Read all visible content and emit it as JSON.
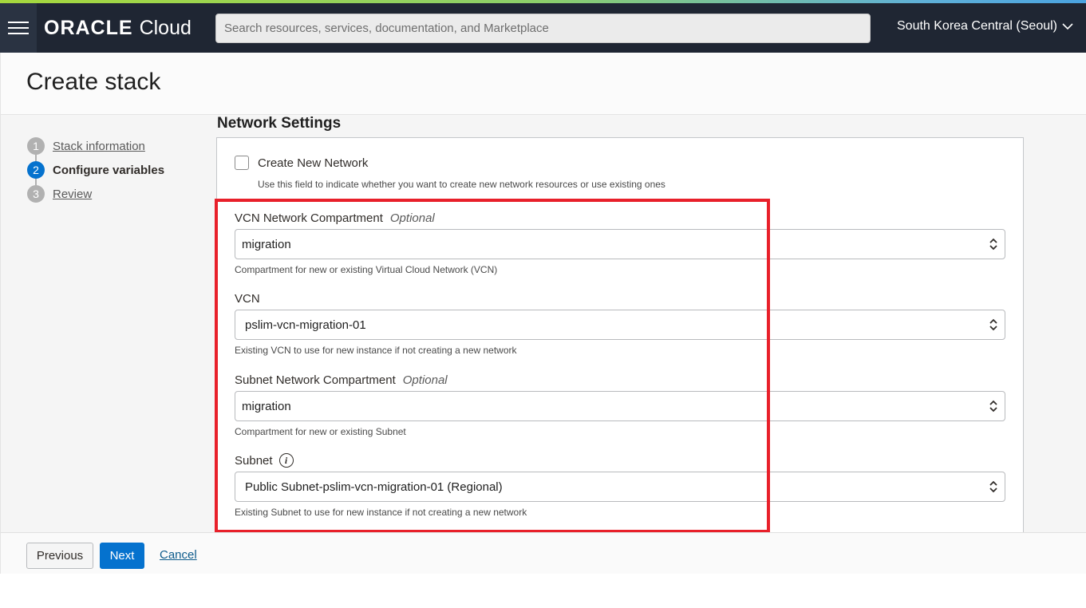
{
  "header": {
    "logo_brand": "ORACLE",
    "logo_product": "Cloud",
    "search_placeholder": "Search resources, services, documentation, and Marketplace",
    "region": "South Korea Central (Seoul)"
  },
  "page": {
    "title": "Create stack"
  },
  "steps": [
    {
      "number": "1",
      "label": "Stack information",
      "state": "completed"
    },
    {
      "number": "2",
      "label": "Configure variables",
      "state": "active"
    },
    {
      "number": "3",
      "label": "Review",
      "state": "pending"
    }
  ],
  "section": {
    "title": "Network Settings",
    "create_network": {
      "label": "Create New Network",
      "checked": false,
      "help": "Use this field to indicate whether you want to create new network resources or use existing ones"
    },
    "fields": [
      {
        "label": "VCN Network Compartment",
        "optional": "Optional",
        "value": "migration",
        "help": "Compartment for new or existing Virtual Cloud Network (VCN)"
      },
      {
        "label": "VCN",
        "value": "pslim-vcn-migration-01",
        "help": "Existing VCN to use for new instance if not creating a new network"
      },
      {
        "label": "Subnet Network Compartment",
        "optional": "Optional",
        "value": "migration",
        "help": "Compartment for new or existing Subnet"
      },
      {
        "label": "Subnet",
        "info_icon": "i",
        "value": "Public Subnet-pslim-vcn-migration-01 (Regional)",
        "help": "Existing Subnet to use for new instance if not creating a new network"
      }
    ]
  },
  "footer": {
    "previous": "Previous",
    "next": "Next",
    "cancel": "Cancel"
  },
  "colors": {
    "header_bg": "#1f2633",
    "primary": "#0572ce",
    "highlight": "#e8202a"
  }
}
